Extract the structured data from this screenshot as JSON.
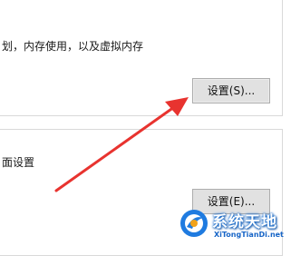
{
  "performance": {
    "description": "划，内存使用，以及虚拟内存",
    "settings_button": "设置(S)..."
  },
  "startup": {
    "description": "面设置",
    "settings_button": "设置(E)..."
  },
  "watermark": {
    "title": "系统天地",
    "subtitle": "XiTongTianDi.net"
  },
  "colors": {
    "arrow": "#e8332f",
    "button_bg": "#e1e1e1",
    "watermark_blue": "#1765c7"
  }
}
